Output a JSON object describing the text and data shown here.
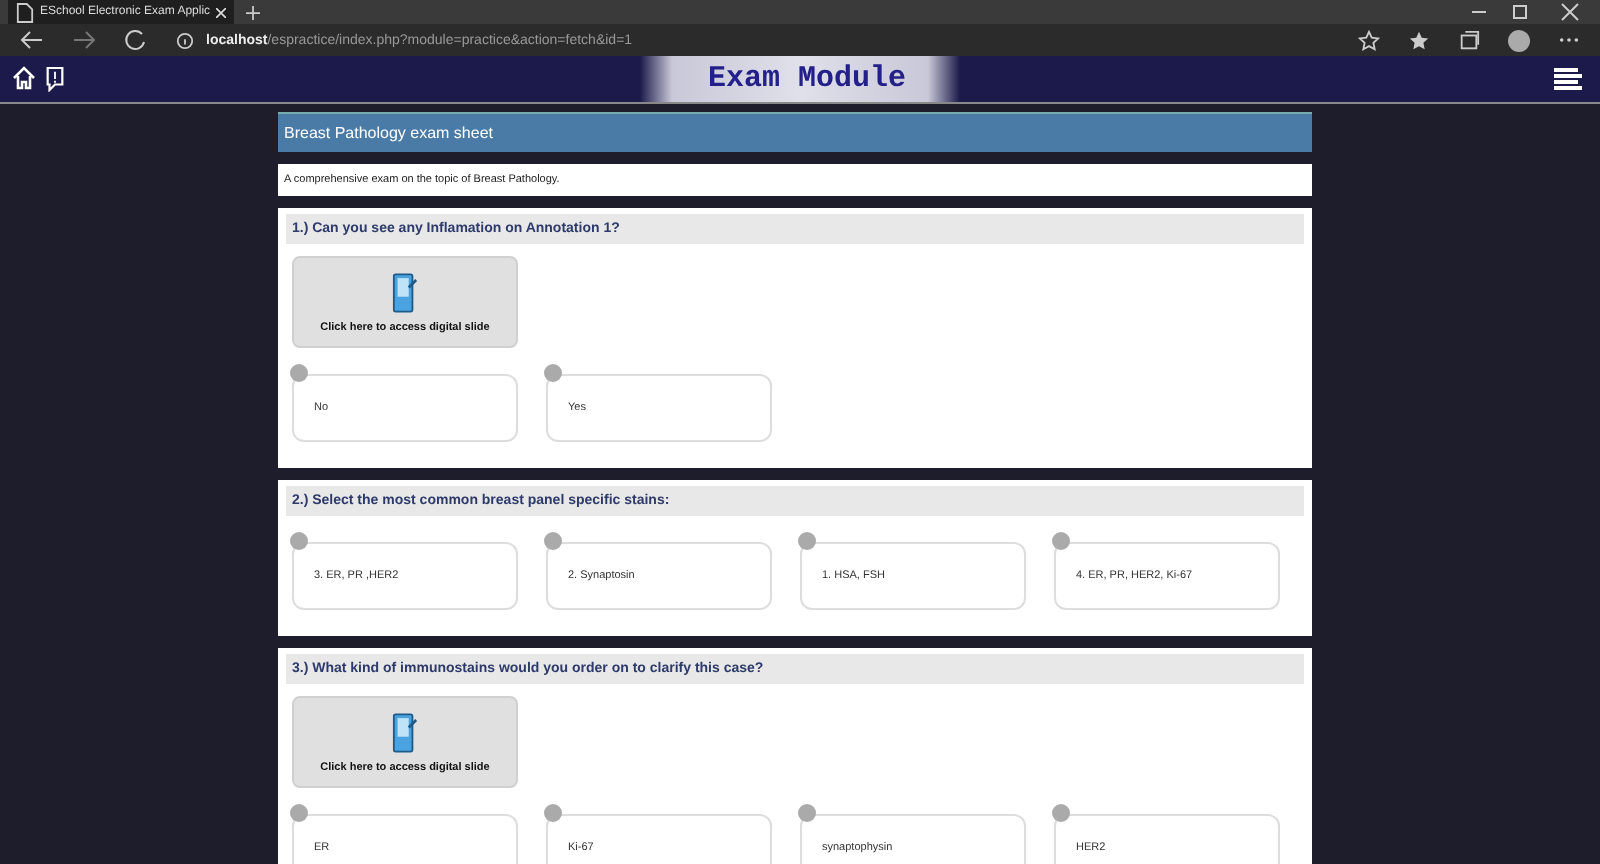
{
  "browser": {
    "tab_title": "ESchool Electronic Exam Applic",
    "url_host": "localhost",
    "url_path": "/espractice/index.php?module=practice&action=fetch&id=1"
  },
  "header": {
    "title": "Exam Module"
  },
  "exam": {
    "title": "Breast Pathology exam sheet",
    "description": "A comprehensive exam on the topic of Breast Pathology."
  },
  "questions": [
    {
      "text": "1.) Can you see any Inflamation on Annotation 1?",
      "slide_link": "Click here to access digital slide",
      "answers": [
        "No",
        "Yes"
      ]
    },
    {
      "text": "2.) Select the most common breast panel specific stains:",
      "answers": [
        "3. ER, PR ,HER2",
        "2. Synaptosin",
        "1. HSA, FSH",
        "4. ER, PR, HER2, Ki-67"
      ]
    },
    {
      "text": "3.) What kind of immunostains would you order on to clarify this case?",
      "slide_link": "Click here to access digital slide",
      "answers": [
        "ER",
        "Ki-67",
        "synaptophysin",
        "HER2"
      ]
    }
  ]
}
